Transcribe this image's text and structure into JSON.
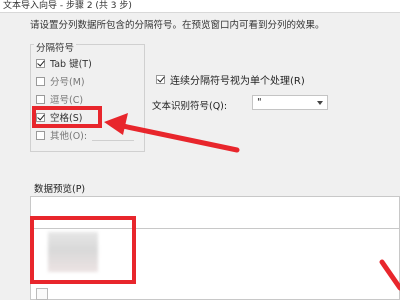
{
  "window": {
    "title": "文本导入向导 - 步骤 2 (共 3 步)"
  },
  "instruction": "请设置分列数据所包含的分隔符号。在预览窗口内可看到分列的效果。",
  "delimiters": {
    "group_label": "分隔符号",
    "tab": {
      "label": "Tab 键(T)",
      "checked": true
    },
    "semicolon": {
      "label": "分号(M)",
      "checked": false
    },
    "comma": {
      "label": "逗号(C)",
      "checked": false
    },
    "space": {
      "label": "空格(S)",
      "checked": true
    },
    "other": {
      "label": "其他(O):",
      "checked": false
    }
  },
  "consecutive": {
    "label": "连续分隔符号视为单个处理(R)",
    "checked": true
  },
  "text_qualifier": {
    "label": "文本识别符号(Q):",
    "value": "\""
  },
  "preview": {
    "label": "数据预览(P)"
  },
  "colors": {
    "annotation_red": "#e8262c"
  }
}
